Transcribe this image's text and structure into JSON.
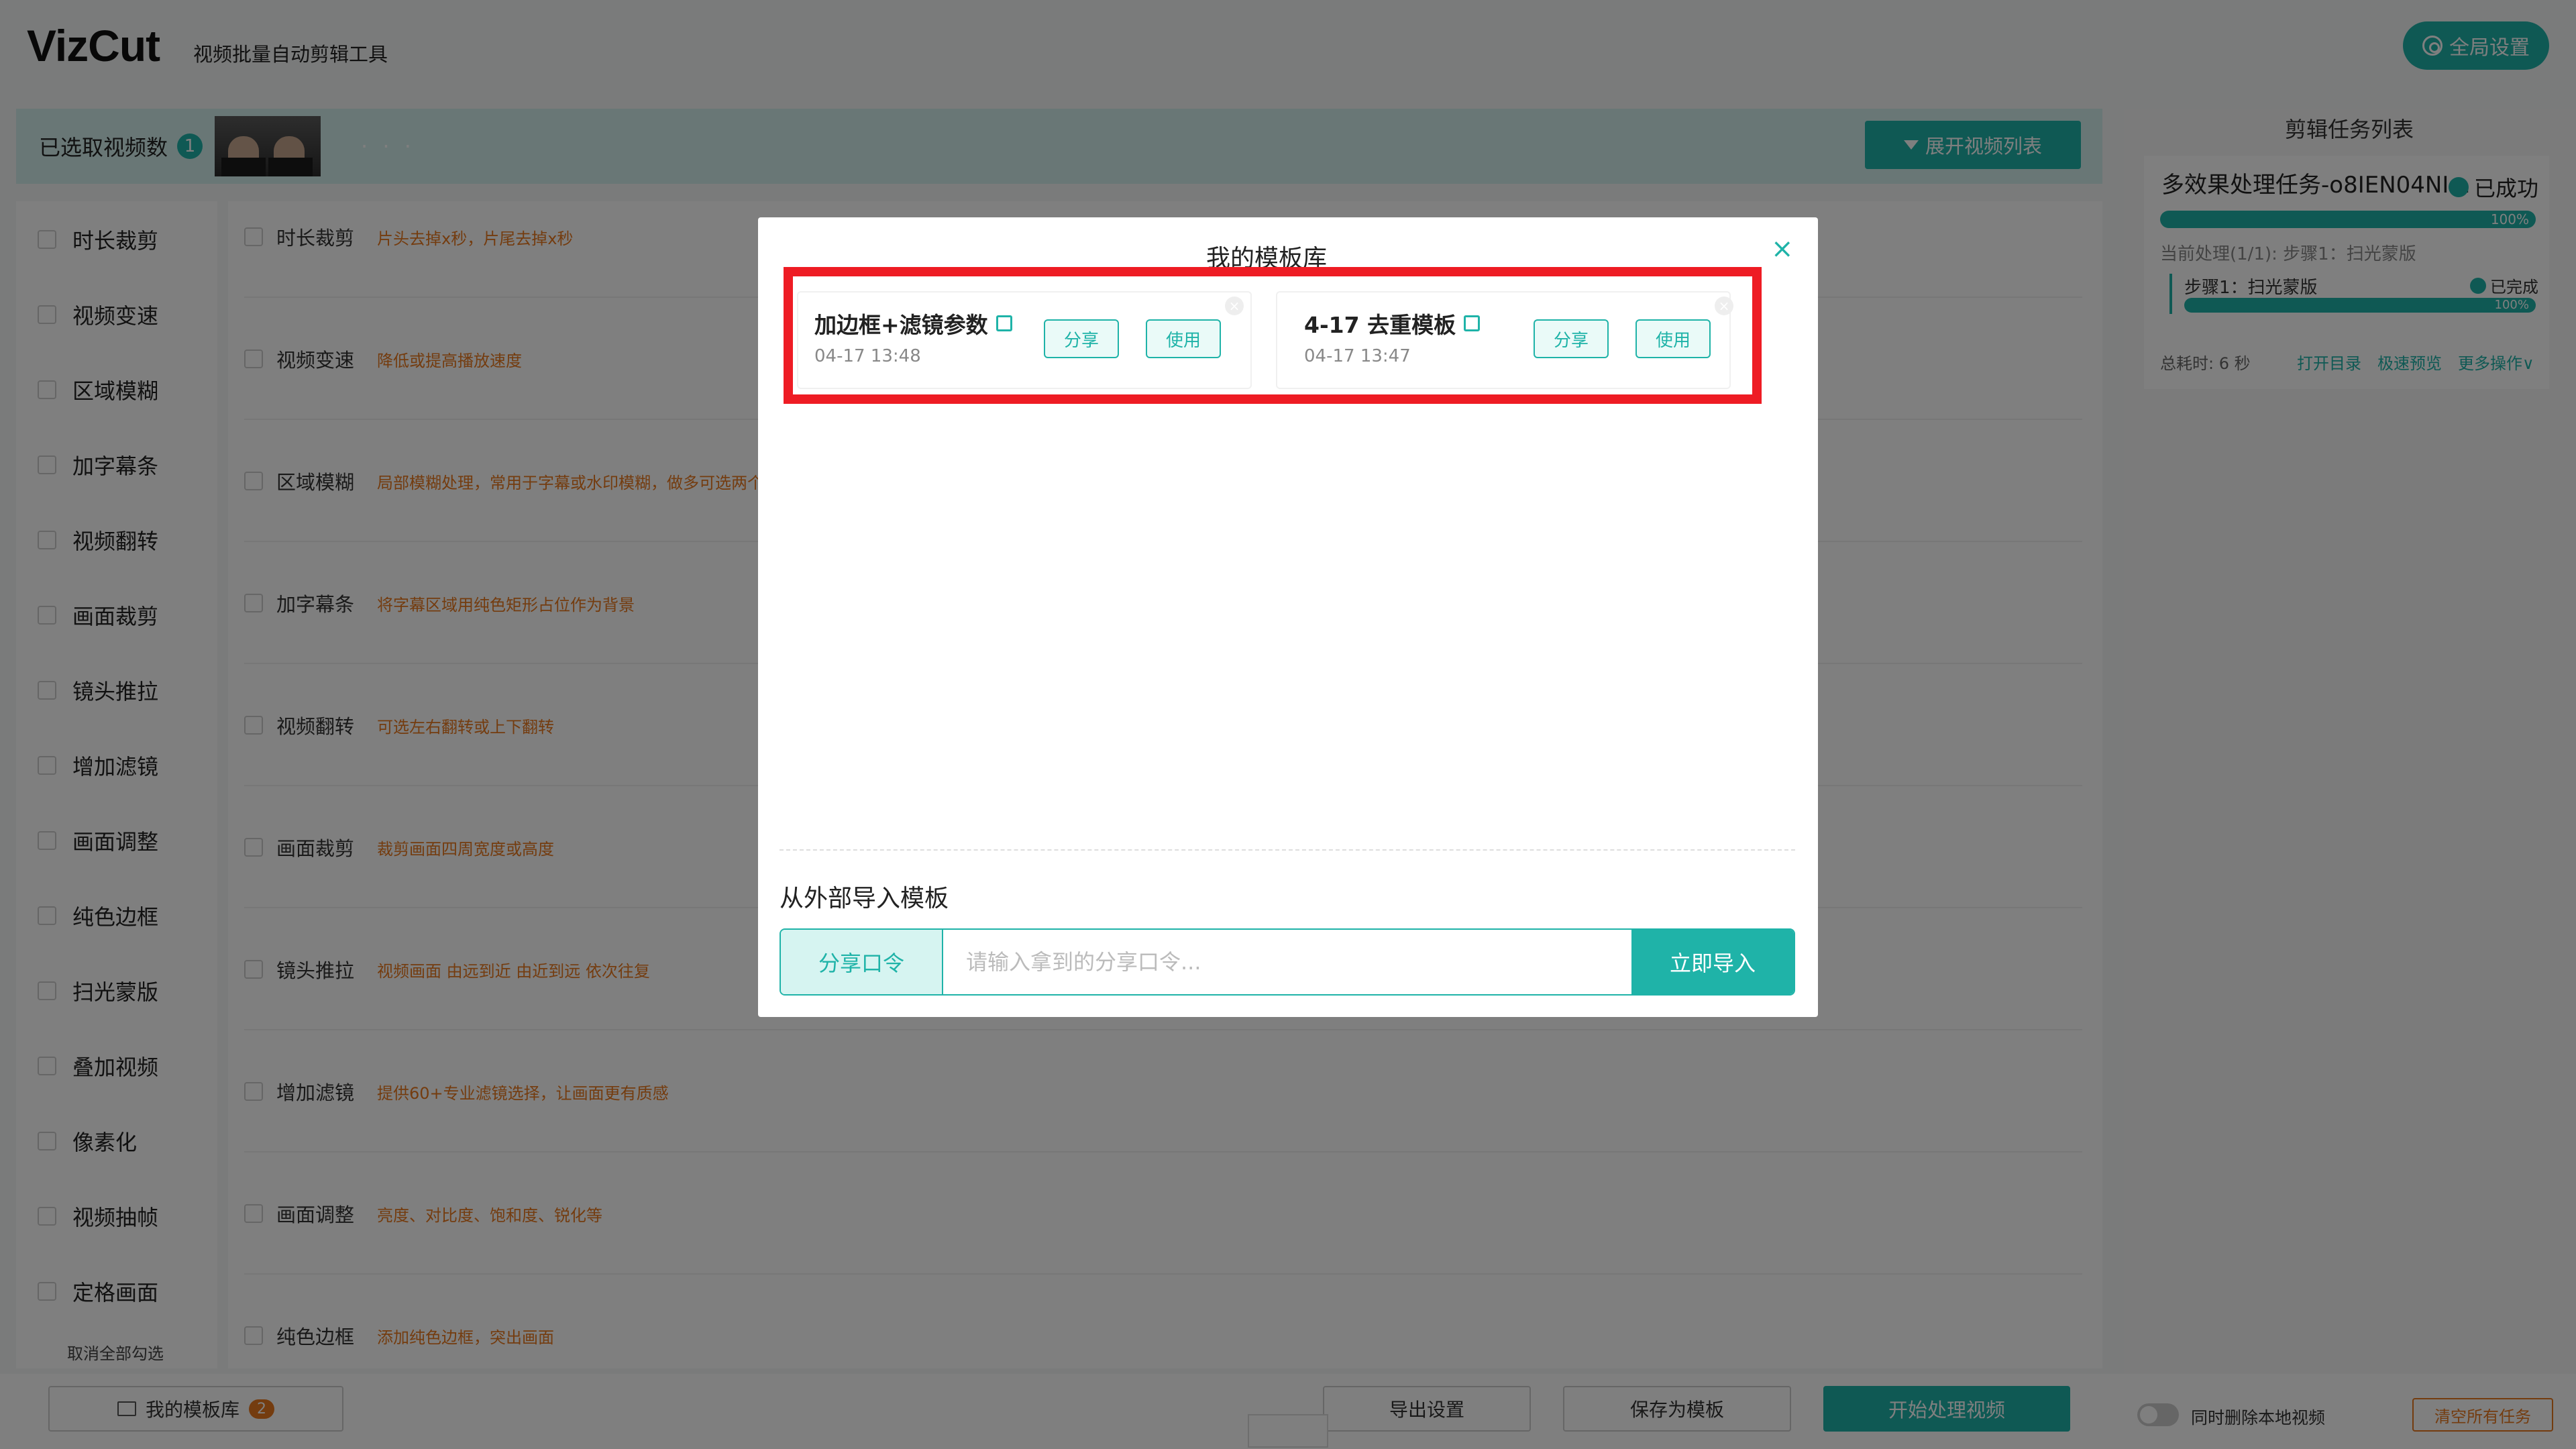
{
  "header": {
    "logo": "VizCut",
    "subtitle": "视频批量自动剪辑工具",
    "global_settings": "全局设置"
  },
  "selected_bar": {
    "label": "已选取视频数",
    "count": "1",
    "expand_label": "展开视频列表",
    "dots": "· · ·"
  },
  "left_options": [
    "时长裁剪",
    "视频变速",
    "区域模糊",
    "加字幕条",
    "视频翻转",
    "画面裁剪",
    "镜头推拉",
    "增加滤镜",
    "画面调整",
    "纯色边框",
    "扫光蒙版",
    "叠加视频",
    "像素化",
    "视频抽帧",
    "定格画面"
  ],
  "cancel_all": "取消全部勾选",
  "middle_rows": [
    {
      "title": "时长裁剪",
      "desc": "片头去掉x秒，片尾去掉x秒"
    },
    {
      "title": "视频变速",
      "desc": "降低或提高播放速度"
    },
    {
      "title": "区域模糊",
      "desc": "局部模糊处理，常用于字幕或水印模糊，做多可选两个区"
    },
    {
      "title": "加字幕条",
      "desc": "将字幕区域用纯色矩形占位作为背景"
    },
    {
      "title": "视频翻转",
      "desc": "可选左右翻转或上下翻转"
    },
    {
      "title": "画面裁剪",
      "desc": "裁剪画面四周宽度或高度"
    },
    {
      "title": "镜头推拉",
      "desc": "视频画面 由远到近 由近到远 依次往复"
    },
    {
      "title": "增加滤镜",
      "desc": "提供60+专业滤镜选择，让画面更有质感"
    },
    {
      "title": "画面调整",
      "desc": "亮度、对比度、饱和度、锐化等"
    },
    {
      "title": "纯色边框",
      "desc": "添加纯色边框，突出画面"
    }
  ],
  "task_panel": {
    "title": "剪辑任务列表",
    "task_name": "多效果处理任务-o8IEN04NI...",
    "status": "已成功",
    "progress": "100%",
    "current": "当前处理(1/1): 步骤1：扫光蒙版",
    "step": "步骤1：扫光蒙版",
    "step_status": "已完成",
    "step_progress": "100%",
    "cost": "总耗时: 6 秒",
    "open_dir": "打开目录",
    "preview": "极速预览",
    "more": "更多操作∨"
  },
  "bottom": {
    "my_templates": "我的模板库",
    "template_count": "2",
    "export_settings": "导出设置",
    "save_template": "保存为模板",
    "start": "开始处理视频",
    "toggle_label": "同时删除本地视频",
    "clear_all": "清空所有任务"
  },
  "modal": {
    "title": "我的模板库",
    "close": "×",
    "templates": [
      {
        "name": "加边框+滤镜参数",
        "time": "04-17 13:48",
        "share": "分享",
        "use": "使用"
      },
      {
        "name": "4-17 去重模板",
        "time": "04-17 13:47",
        "share": "分享",
        "use": "使用"
      }
    ],
    "import_title": "从外部导入模板",
    "import_label": "分享口令",
    "import_placeholder": "请输入拿到的分享口令...",
    "import_button": "立即导入"
  },
  "colors": {
    "accent": "#1fb3a8",
    "warning": "#e8781e",
    "highlight": "#ee1c24"
  }
}
